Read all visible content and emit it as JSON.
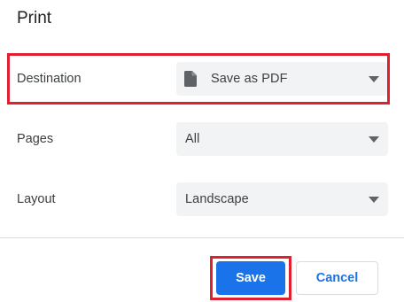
{
  "dialog": {
    "title": "Print"
  },
  "settings": {
    "destination": {
      "label": "Destination",
      "value": "Save as PDF",
      "icon": "document-icon"
    },
    "pages": {
      "label": "Pages",
      "value": "All"
    },
    "layout": {
      "label": "Layout",
      "value": "Landscape"
    }
  },
  "actions": {
    "save_label": "Save",
    "cancel_label": "Cancel"
  },
  "colors": {
    "accent": "#1a73e8",
    "highlight": "#e0202f",
    "field_background": "#f1f3f4"
  }
}
